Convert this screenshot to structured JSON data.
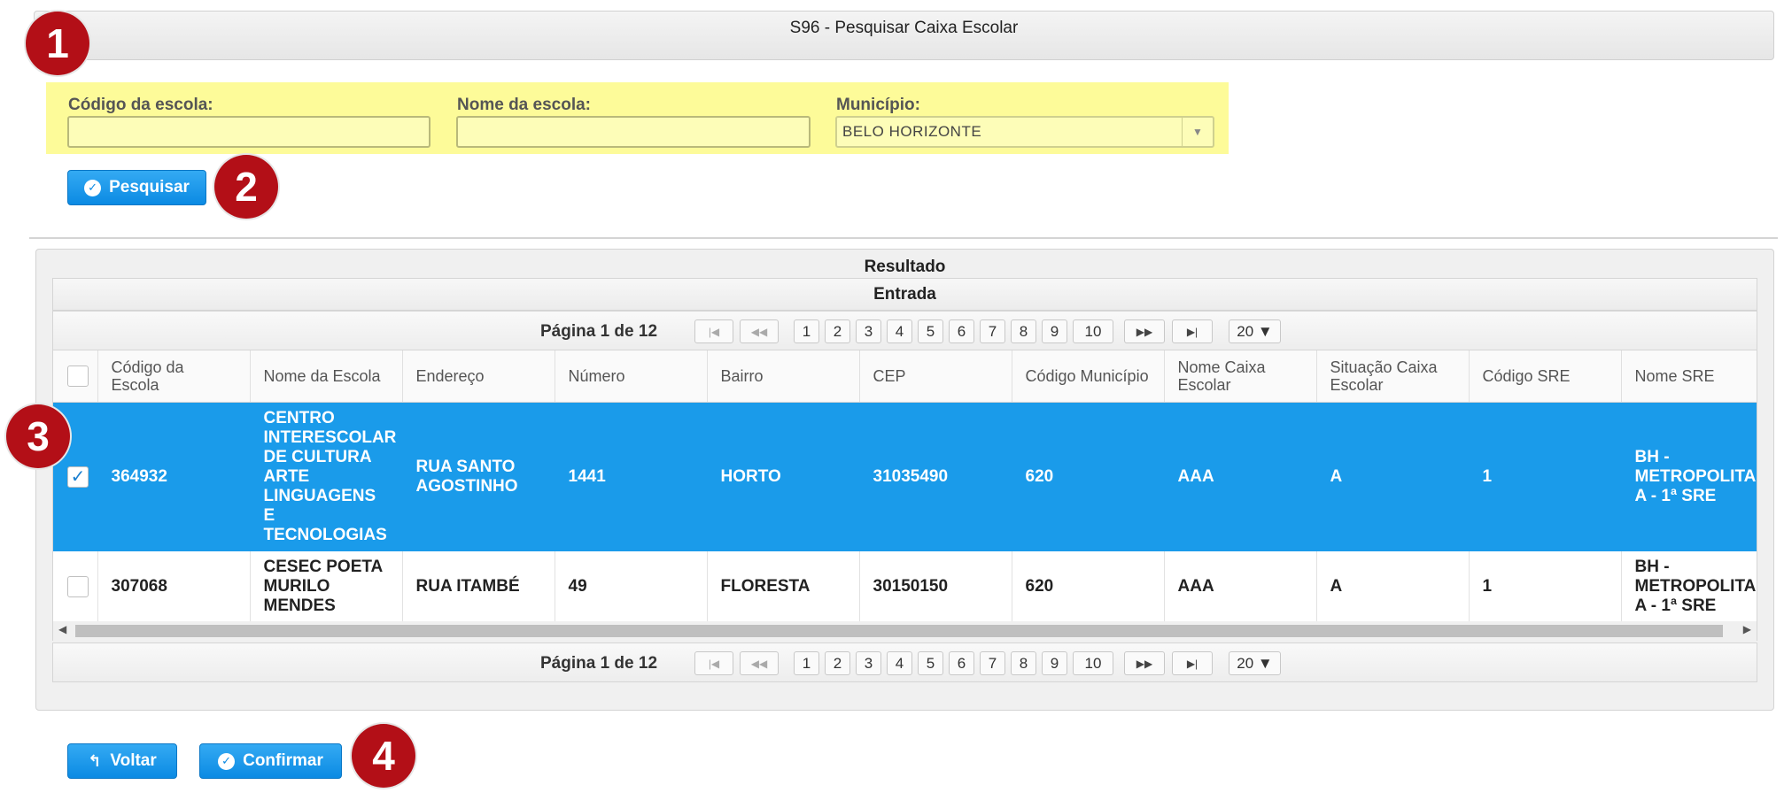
{
  "title": "S96 - Pesquisar Caixa Escolar",
  "markers": [
    "1",
    "2",
    "3",
    "4"
  ],
  "filters": {
    "codigo_label": "Código da escola:",
    "codigo_value": "",
    "nome_label": "Nome da escola:",
    "nome_value": "",
    "municipio_label": "Município:",
    "municipio_value": "BELO HORIZONTE"
  },
  "buttons": {
    "pesquisar": "Pesquisar",
    "voltar": "Voltar",
    "confirmar": "Confirmar"
  },
  "result": {
    "title": "Resultado",
    "subtitle": "Entrada",
    "page_info": "Página 1 de 12",
    "pages": [
      "1",
      "2",
      "3",
      "4",
      "5",
      "6",
      "7",
      "8",
      "9",
      "10"
    ],
    "page_size": "20 ▼",
    "columns": [
      "Código da Escola",
      "Nome da Escola",
      "Endereço",
      "Número",
      "Bairro",
      "CEP",
      "Código Município",
      "Nome Caixa Escolar",
      "Situação Caixa Escolar",
      "Código SRE",
      "Nome SRE"
    ],
    "rows": [
      {
        "selected": true,
        "cells": [
          "364932",
          "CENTRO INTERESCOLAR DE CULTURA ARTE LINGUAGENS E TECNOLOGIAS",
          "RUA SANTO AGOSTINHO",
          "1441",
          "HORTO",
          "31035490",
          "620",
          "AAA",
          "A",
          "1",
          "BH - METROPOLITA A - 1ª SRE"
        ]
      },
      {
        "selected": false,
        "cells": [
          "307068",
          "CESEC POETA MURILO MENDES",
          "RUA ITAMBÉ",
          "49",
          "FLORESTA",
          "30150150",
          "620",
          "AAA",
          "A",
          "1",
          "BH - METROPOLITA A - 1ª SRE"
        ]
      }
    ]
  },
  "colors": {
    "accent": "#1a9bea",
    "marker": "#b30f17",
    "filter_bg": "#fdfb99"
  }
}
